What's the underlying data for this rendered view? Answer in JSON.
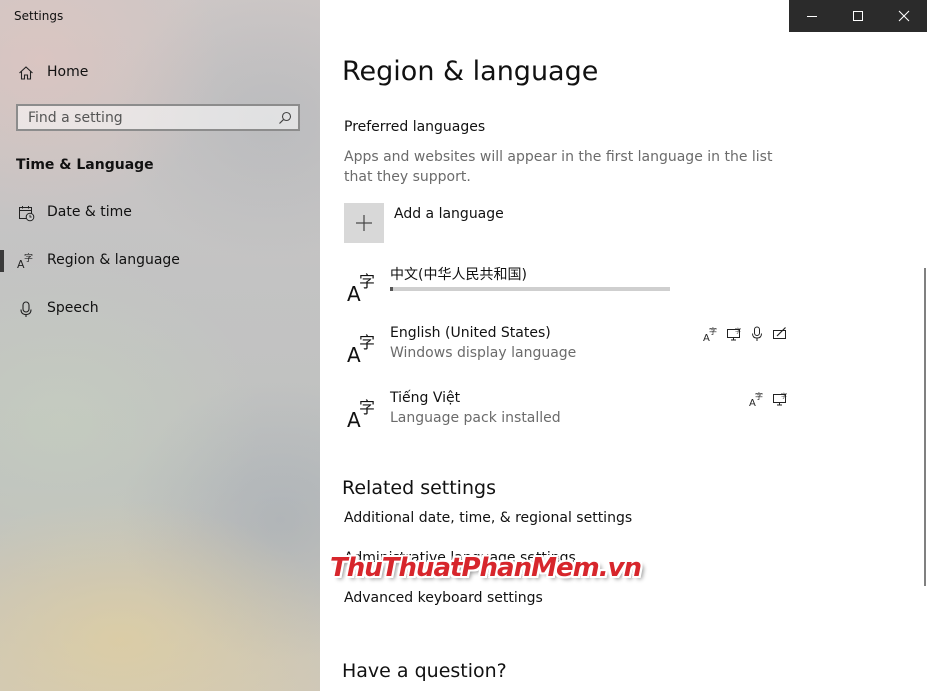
{
  "window": {
    "app_title": "Settings"
  },
  "sidebar": {
    "home_label": "Home",
    "search_placeholder": "Find a setting",
    "section_heading": "Time & Language",
    "items": [
      {
        "label": "Date & time",
        "icon": "calendar-clock-icon",
        "selected": false
      },
      {
        "label": "Region & language",
        "icon": "language-icon",
        "selected": true
      },
      {
        "label": "Speech",
        "icon": "microphone-icon",
        "selected": false
      }
    ]
  },
  "main": {
    "page_title": "Region & language",
    "preferred_heading": "Preferred languages",
    "preferred_description": "Apps and websites will appear in the first language in the list that they support.",
    "add_language_label": "Add a language",
    "languages": [
      {
        "name": "中文(中华人民共和国)",
        "subtitle": "",
        "progress": 0.01,
        "features": []
      },
      {
        "name": "English (United States)",
        "subtitle": "Windows display language",
        "features": [
          "language-pack-icon",
          "display-language-icon",
          "speech-icon",
          "handwriting-icon"
        ]
      },
      {
        "name": "Tiếng Việt",
        "subtitle": "Language pack installed",
        "features": [
          "language-pack-icon",
          "display-language-icon"
        ]
      }
    ],
    "related_heading": "Related settings",
    "related_links": [
      "Additional date, time, & regional settings",
      "Administrative language settings",
      "Advanced keyboard settings"
    ],
    "question_heading": "Have a question?"
  },
  "watermark": {
    "text": "ThuThuatPhanMem",
    "suffix": ".vn"
  },
  "colors": {
    "titlebar": "#2b2b2b",
    "watermark": "#d7262c",
    "secondary_text": "#6b6b6b"
  }
}
